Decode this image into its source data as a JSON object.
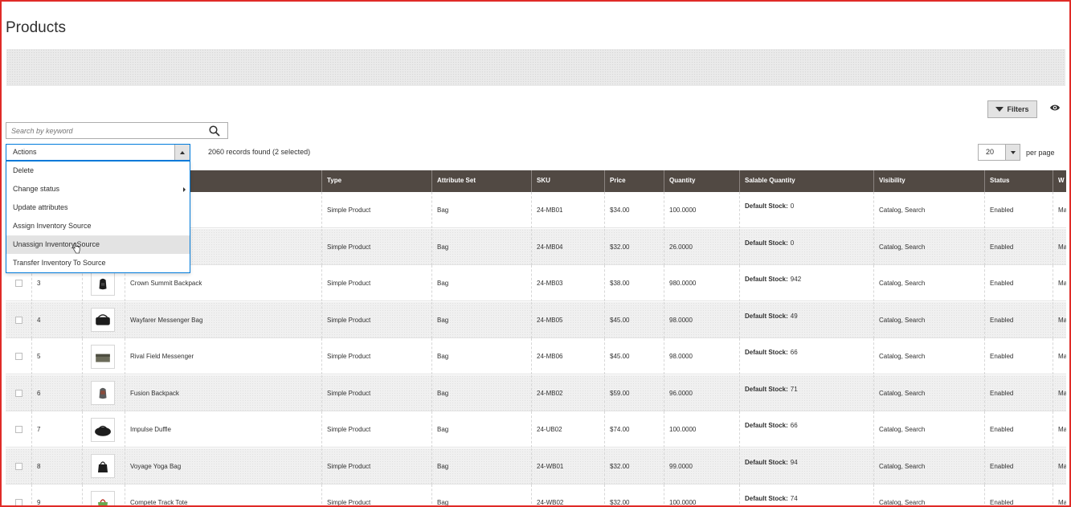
{
  "page": {
    "title": "Products"
  },
  "toolbar": {
    "filters_label": "Filters",
    "search_placeholder": "Search by keyword",
    "actions_label": "Actions",
    "records_text": "2060 records found (2 selected)",
    "per_page_value": "20",
    "per_page_label": "per page"
  },
  "actions_menu": [
    {
      "label": "Delete"
    },
    {
      "label": "Change status"
    },
    {
      "label": "Update attributes"
    },
    {
      "label": "Assign Inventory Source"
    },
    {
      "label": "Unassign Inventory Source"
    },
    {
      "label": "Transfer Inventory To Source"
    }
  ],
  "columns": [
    "Type",
    "Attribute Set",
    "SKU",
    "Price",
    "Quantity",
    "Salable Quantity",
    "Visibility",
    "Status",
    "W"
  ],
  "stock_label": "Default Stock:",
  "rows": [
    {
      "id": "",
      "name": "",
      "type": "Simple Product",
      "attribute_set": "Bag",
      "sku": "24-MB01",
      "price": "$34.00",
      "quantity": "100.0000",
      "salable": "0",
      "visibility": "Catalog, Search",
      "status": "Enabled",
      "website": "Ma"
    },
    {
      "id": "",
      "name": "",
      "type": "Simple Product",
      "attribute_set": "Bag",
      "sku": "24-MB04",
      "price": "$32.00",
      "quantity": "26.0000",
      "salable": "0",
      "visibility": "Catalog, Search",
      "status": "Enabled",
      "website": "Ma"
    },
    {
      "id": "3",
      "name": "Crown Summit Backpack",
      "type": "Simple Product",
      "attribute_set": "Bag",
      "sku": "24-MB03",
      "price": "$38.00",
      "quantity": "980.0000",
      "salable": "942",
      "visibility": "Catalog, Search",
      "status": "Enabled",
      "website": "Ma"
    },
    {
      "id": "4",
      "name": "Wayfarer Messenger Bag",
      "type": "Simple Product",
      "attribute_set": "Bag",
      "sku": "24-MB05",
      "price": "$45.00",
      "quantity": "98.0000",
      "salable": "49",
      "visibility": "Catalog, Search",
      "status": "Enabled",
      "website": "Ma"
    },
    {
      "id": "5",
      "name": "Rival Field Messenger",
      "type": "Simple Product",
      "attribute_set": "Bag",
      "sku": "24-MB06",
      "price": "$45.00",
      "quantity": "98.0000",
      "salable": "66",
      "visibility": "Catalog, Search",
      "status": "Enabled",
      "website": "Ma"
    },
    {
      "id": "6",
      "name": "Fusion Backpack",
      "type": "Simple Product",
      "attribute_set": "Bag",
      "sku": "24-MB02",
      "price": "$59.00",
      "quantity": "96.0000",
      "salable": "71",
      "visibility": "Catalog, Search",
      "status": "Enabled",
      "website": "Ma"
    },
    {
      "id": "7",
      "name": "Impulse Duffle",
      "type": "Simple Product",
      "attribute_set": "Bag",
      "sku": "24-UB02",
      "price": "$74.00",
      "quantity": "100.0000",
      "salable": "66",
      "visibility": "Catalog, Search",
      "status": "Enabled",
      "website": "Ma"
    },
    {
      "id": "8",
      "name": "Voyage Yoga Bag",
      "type": "Simple Product",
      "attribute_set": "Bag",
      "sku": "24-WB01",
      "price": "$32.00",
      "quantity": "99.0000",
      "salable": "94",
      "visibility": "Catalog, Search",
      "status": "Enabled",
      "website": "Ma"
    },
    {
      "id": "9",
      "name": "Compete Track Tote",
      "type": "Simple Product",
      "attribute_set": "Bag",
      "sku": "24-WB02",
      "price": "$32.00",
      "quantity": "100.0000",
      "salable": "74",
      "visibility": "Catalog, Search",
      "status": "Enabled",
      "website": "Ma"
    }
  ]
}
